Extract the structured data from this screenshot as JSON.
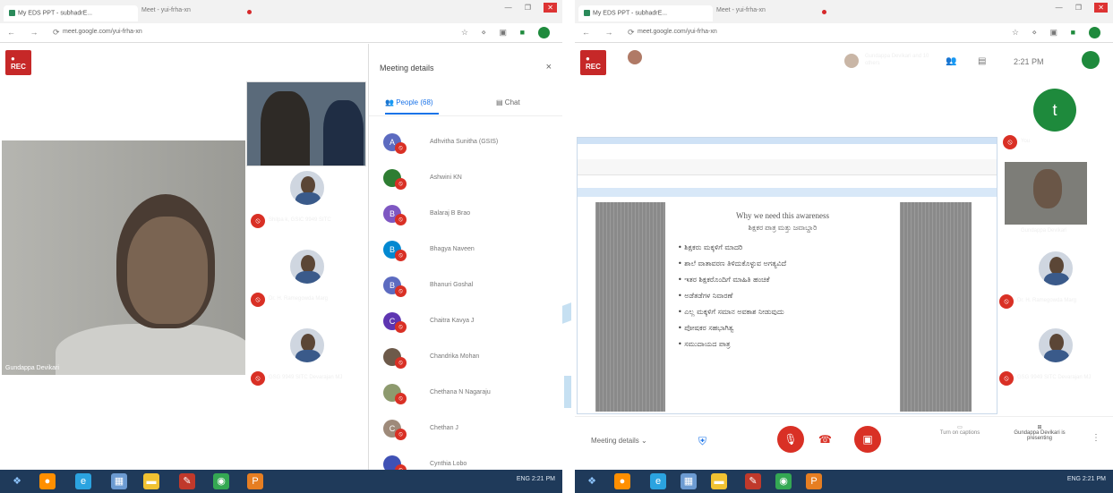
{
  "left": {
    "tab_title": "My EDS PPT - subhadrE...",
    "tab2_title": "Meet - yui-frha-xn",
    "url": "meet.google.com/yui-frha-xn",
    "rec_label": "REC",
    "main_name": "Gundappa Devikari",
    "tiles": [
      {
        "name": "Shilpa k, GSIC 9949 SITC"
      },
      {
        "name": "Dr. H. Ramegowda Marg"
      },
      {
        "name": "GSG 9949 SITC Devarajan MJ"
      }
    ],
    "panel_title": "Meeting details",
    "close_glyph": "×",
    "people_tab": "People (68)",
    "chat_tab": "Chat",
    "people": [
      {
        "initial": "A",
        "name": "Adhvitha Sunitha (GSIS)"
      },
      {
        "initial": "",
        "name": "Ashwini KN"
      },
      {
        "initial": "B",
        "name": "Balaraj B Brao"
      },
      {
        "initial": "B",
        "name": "Bhagya Naveen"
      },
      {
        "initial": "B",
        "name": "Bhanuri Goshal"
      },
      {
        "initial": "C",
        "name": "Chaitra Kavya J"
      },
      {
        "initial": "",
        "name": "Chandrika Mohan"
      },
      {
        "initial": "",
        "name": "Chethana N Nagaraju"
      },
      {
        "initial": "C",
        "name": "Chethan J"
      },
      {
        "initial": "",
        "name": "Cynthia Lobo"
      }
    ]
  },
  "right": {
    "tab_title": "My EDS PPT - subhadrE...",
    "tab2_title": "Meet - yui-frha-xn",
    "url": "meet.google.com/yui-frha-xn",
    "rec_label": "REC",
    "presenting_text": "Gundappa Devikari is presenting",
    "you_presenting": "Gundappa Devikari and 10 others",
    "time": "2:21 PM",
    "you_label": "You",
    "tile_names": [
      "Gundappa Devikari",
      "Dr. H. Ramegowda Marg",
      "GSG 9949 SITC Devarajan MJ"
    ],
    "slide": {
      "title": "Why we need this awareness",
      "subtitle": "ಶಿಕ್ಷಕರ ಪಾತ್ರ ಮತ್ತು ಜವಾಬ್ದಾರಿ",
      "bullets": [
        "ಶಿಕ್ಷಕರು ಮಕ್ಕಳಿಗೆ ಮಾದರಿ",
        "ಶಾಲೆ ವಾತಾವರಣ ತಿಳಿದುಕೊಳ್ಳುವ ಅಗತ್ಯವಿದೆ",
        "ಇತರ ಶಿಕ್ಷಕರೊಂದಿಗೆ ಮಾಹಿತಿ ಹಂಚಿಕೆ",
        "ಅಡೆತಡೆಗಳ ನಿವಾರಣೆ",
        "ಎಲ್ಲ ಮಕ್ಕಳಿಗೆ ಸಮಾನ ಅವಕಾಶ ನೀಡುವುದು",
        "ಪೋಷಕರ ಸಹಭಾಗಿತ್ವ",
        "ಸಮುದಾಯದ ಪಾತ್ರ"
      ]
    },
    "meeting_details": "Meeting details",
    "captions_label": "Turn on captions",
    "present_label": "Gundappa Devikari is presenting"
  },
  "taskbar": {
    "tray_left": "ENG 2:21 PM",
    "tray_right": "ENG 2:21 PM"
  },
  "colors": {
    "accent_blue": "#1a73e8",
    "rec_red": "#c62828",
    "mute_red": "#d93025",
    "meet_green": "#1e8a3c"
  }
}
